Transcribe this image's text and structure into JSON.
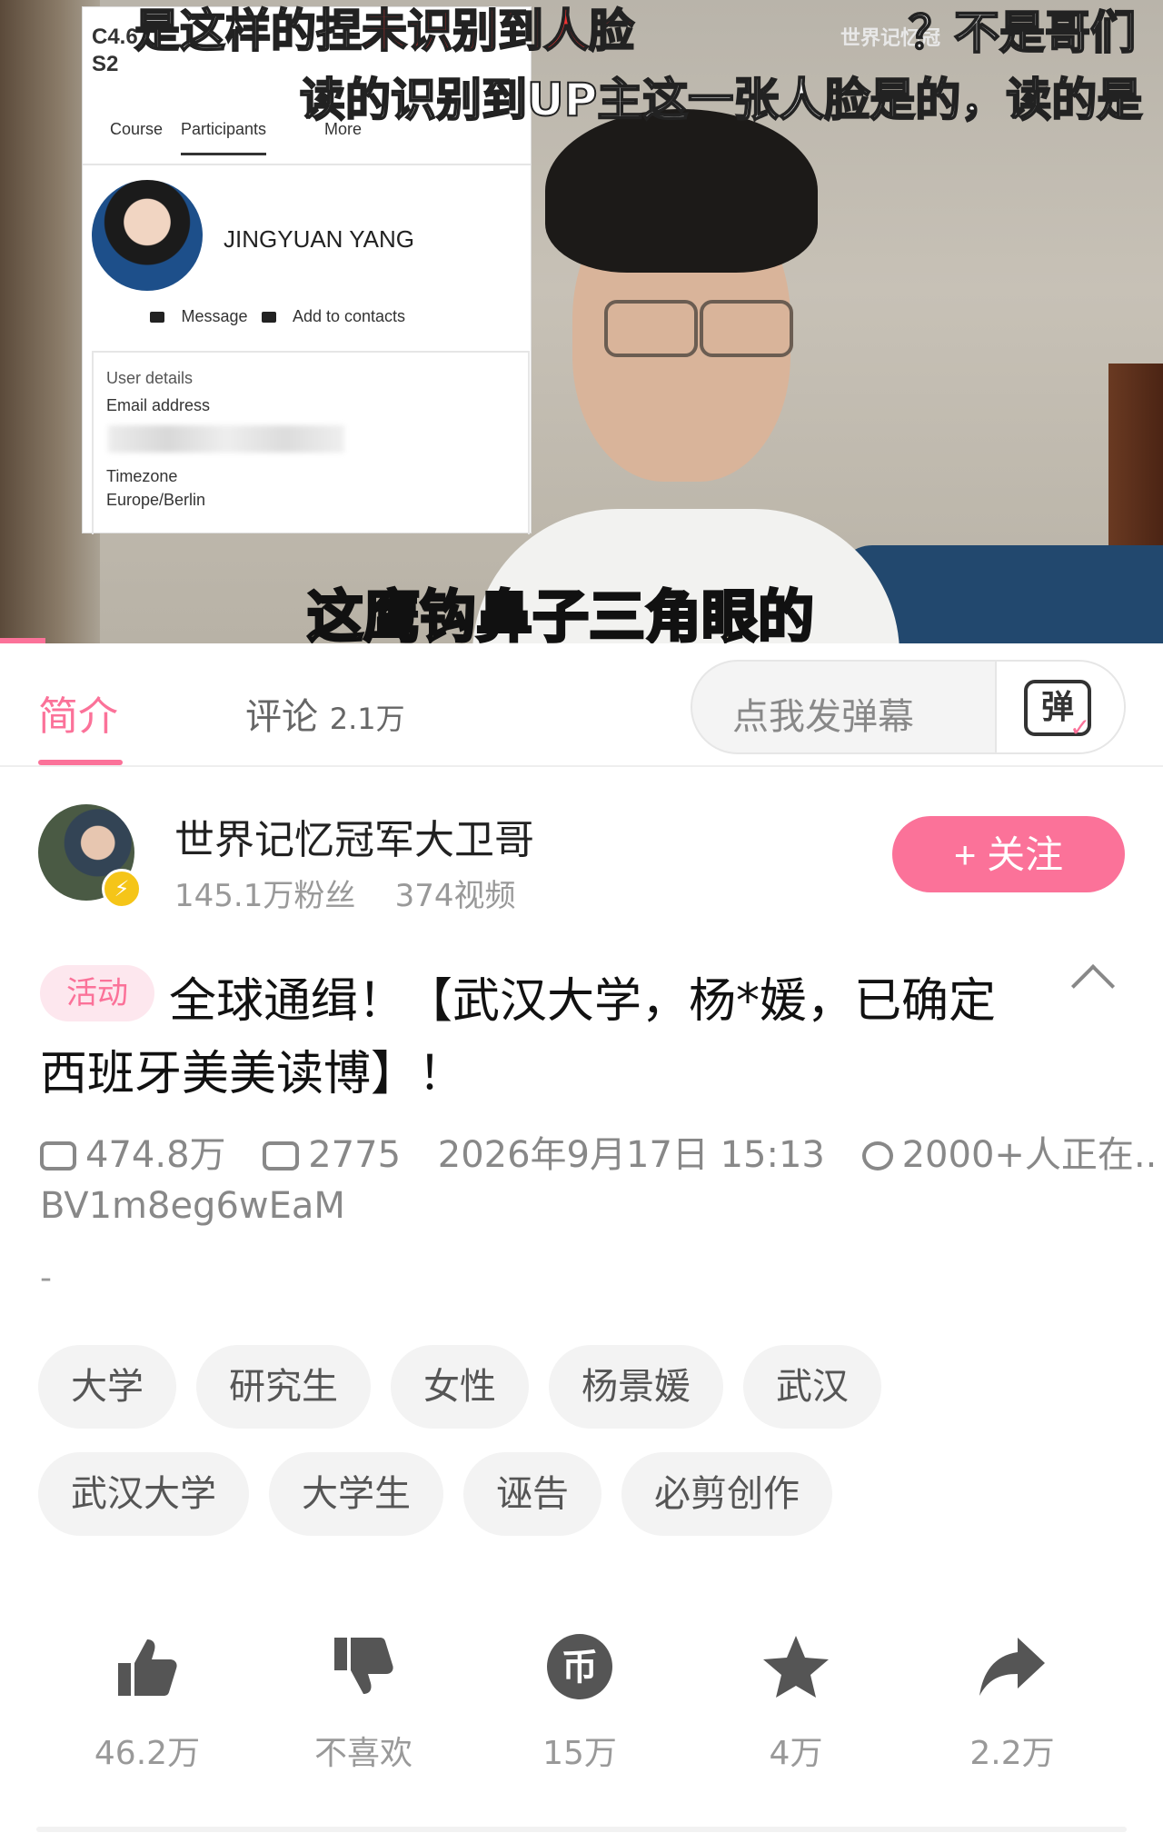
{
  "video": {
    "screenshot": {
      "course_code": "C4.6",
      "course_line2": "S2",
      "tabs": [
        "Course",
        "Participants",
        "More"
      ],
      "user_name": "JINGYUAN YANG",
      "message_label": "Message",
      "add_contacts_label": "Add to contacts",
      "details_heading": "User details",
      "email_label": "Email address",
      "timezone_label": "Timezone",
      "timezone_value": "Europe/Berlin"
    },
    "captions": {
      "top_left_prefix": "是这样的捏",
      "top_left_red": "未识别到人脸",
      "top_right": "？不是哥们",
      "top_right_small": "世界记忆冠",
      "second_line": "读的识别到UP主这一张人脸是的，读的是",
      "bottom": "这鹰钩鼻子三角眼的"
    }
  },
  "tabs": {
    "intro": "简介",
    "comments": "评论",
    "comments_count": "2.1万",
    "danmu_placeholder": "点我发弹幕",
    "danmu_icon_char": "弹"
  },
  "uploader": {
    "name": "世界记忆冠军大卫哥",
    "fans": "145.1万粉丝",
    "videos": "374视频",
    "follow_label": "+ 关注"
  },
  "post": {
    "activity_tag": "活动",
    "title": "全球通缉！【武汉大学，杨*媛，已确定西班牙美美读博】！",
    "views": "474.8万",
    "danmaku": "2775",
    "datetime": "2026年9月17日 15:13",
    "watching": "2000+人正在..",
    "bvid": "BV1m8eg6wEaM",
    "description": "-"
  },
  "tags": [
    "大学",
    "研究生",
    "女性",
    "杨景媛",
    "武汉",
    "武汉大学",
    "大学生",
    "诬告",
    "必剪创作"
  ],
  "actions": {
    "like": "46.2万",
    "dislike": "不喜欢",
    "coin": "15万",
    "favorite": "4万",
    "share": "2.2万"
  },
  "colors": {
    "accent": "#fb7299",
    "muted": "#999999"
  }
}
